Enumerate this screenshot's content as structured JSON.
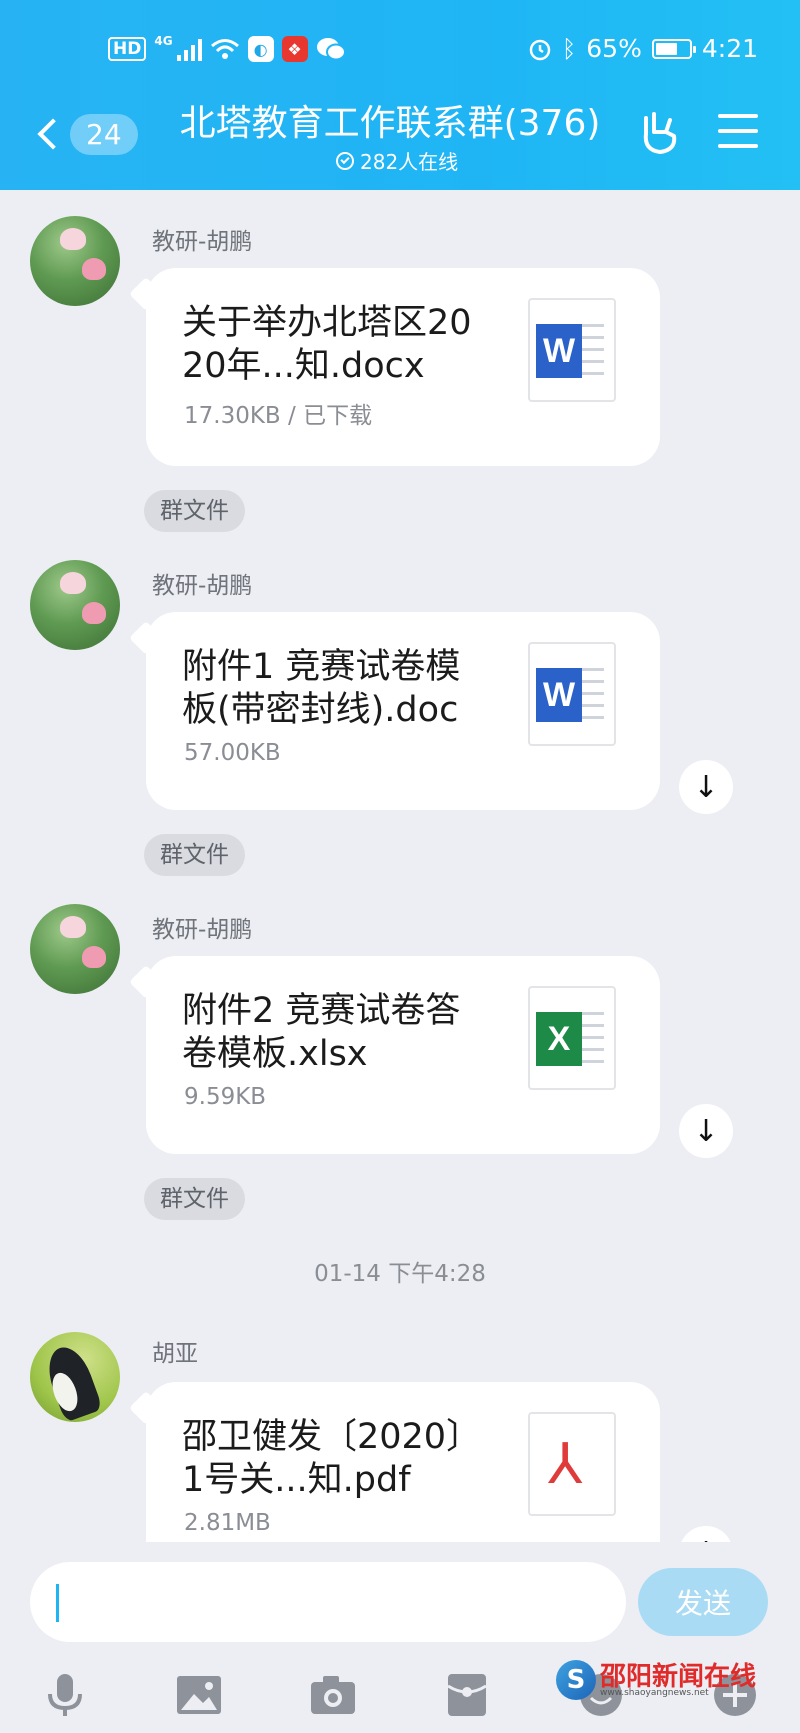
{
  "status_bar": {
    "hd": "HD",
    "network": "4G",
    "battery": "65%",
    "battery_level": 0.65,
    "time": "4:21"
  },
  "header": {
    "back_count": "24",
    "title": "北塔教育工作联系群(376)",
    "online": "282人在线"
  },
  "messages": [
    {
      "sender": "教研-胡鹏",
      "file_name": "关于举办北塔区2020年...知.docx",
      "file_meta": "17.30KB / 已下载",
      "file_type": "word",
      "badge": "W",
      "tag": "群文件"
    },
    {
      "sender": "教研-胡鹏",
      "file_name": "附件1  竞赛试卷模板(带密封线).doc",
      "file_meta": "57.00KB",
      "file_type": "word",
      "badge": "W",
      "tag": "群文件",
      "download": "↓"
    },
    {
      "sender": "教研-胡鹏",
      "file_name": "附件2 竞赛试卷答卷模板.xlsx",
      "file_meta": "9.59KB",
      "file_type": "excel",
      "badge": "X",
      "tag": "群文件",
      "download": "↓"
    },
    {
      "sender": "胡亚",
      "file_name": "邵卫健发〔2020〕1号关...知.pdf",
      "file_meta": "2.81MB",
      "file_type": "pdf",
      "download": "↓"
    }
  ],
  "timestamp": "01-14 下午4:28",
  "input": {
    "value": "",
    "send_label": "发送"
  },
  "toolbar": [
    "mic-icon",
    "image-icon",
    "camera-icon",
    "red-packet-icon",
    "emoji-icon",
    "plus-icon"
  ],
  "watermark": {
    "logo": "S",
    "text": "邵阳新闻在线",
    "url": "www.shaoyangnews.net"
  },
  "colors": {
    "header": "#1fb5f5",
    "background": "#eceef3",
    "word": "#2a62c9",
    "excel": "#1d8a47",
    "pdf": "#e03b3b"
  }
}
